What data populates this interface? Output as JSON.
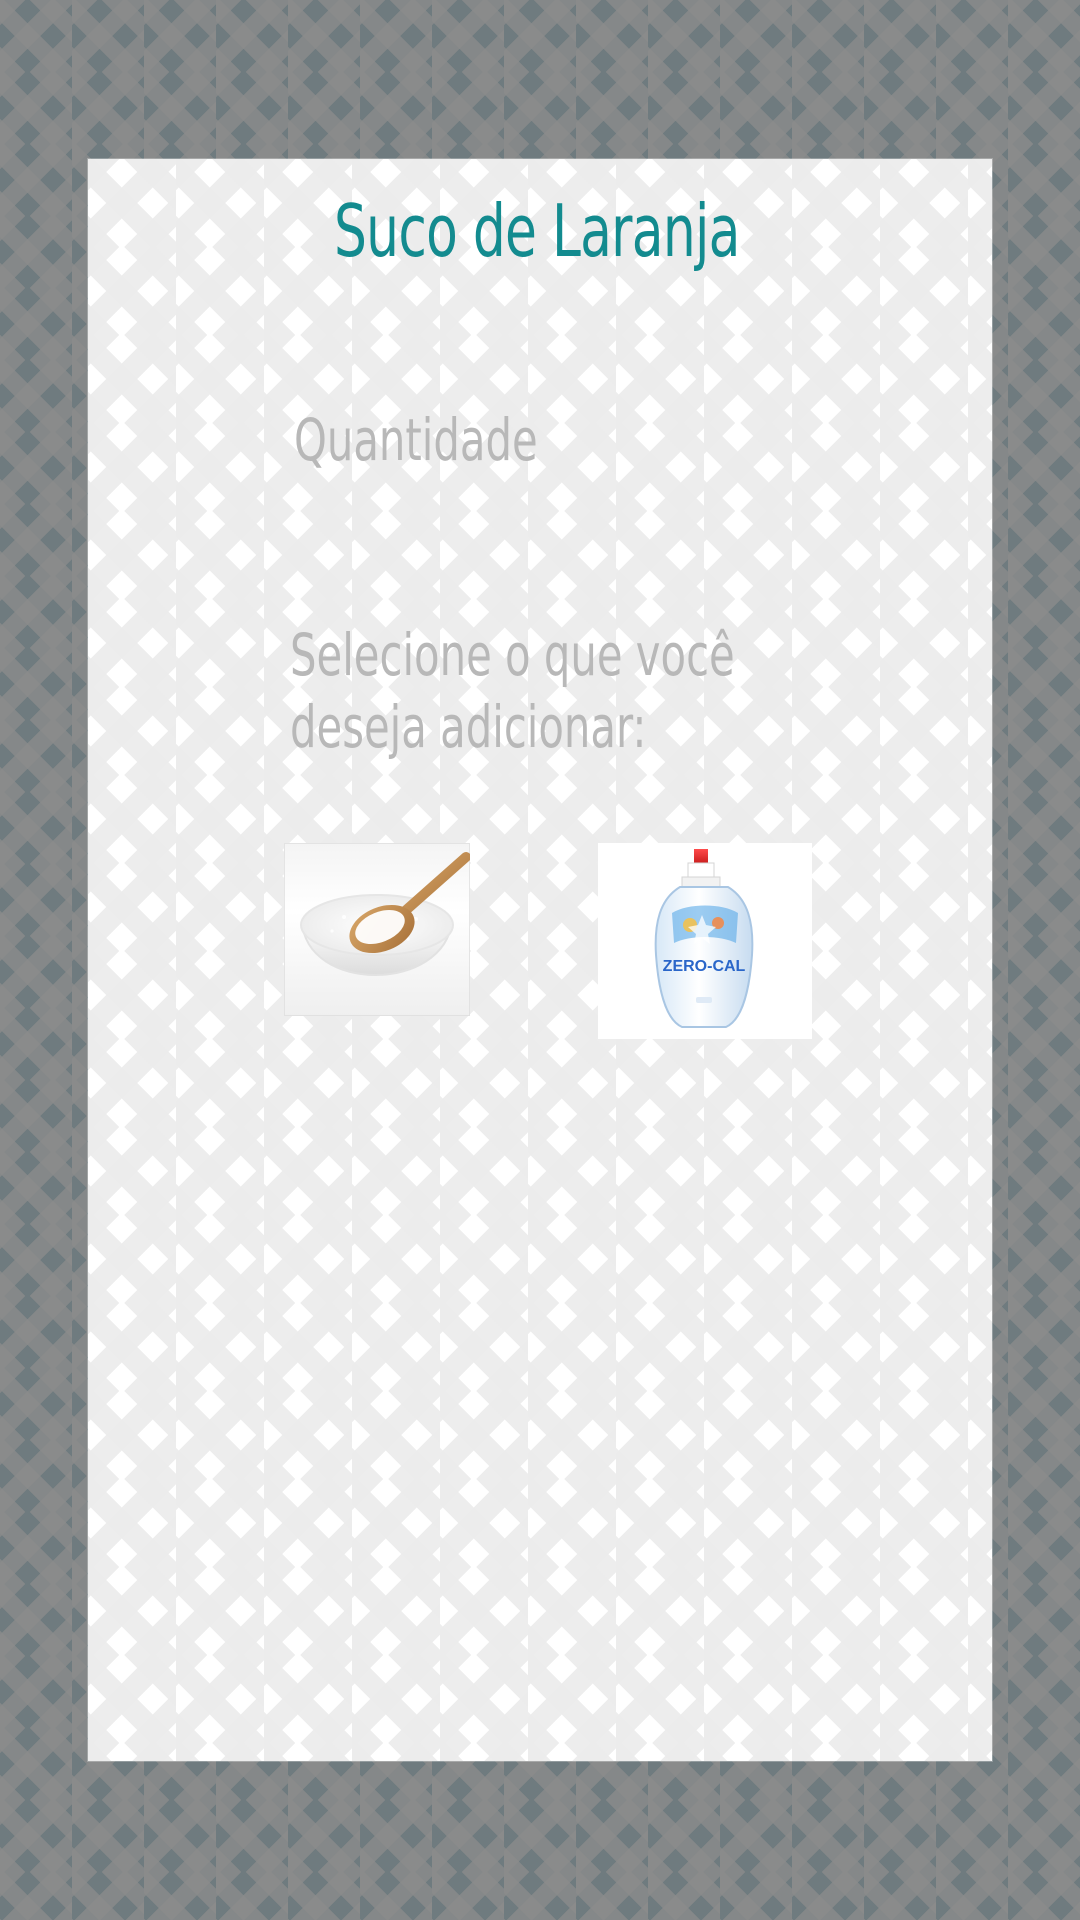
{
  "page": {
    "title": "Suco de Laranja",
    "quantity_label": "Quantidade",
    "prompt": "Selecione o que você deseja adicionar:"
  },
  "options": {
    "sugar": {
      "icon": "sugar-bowl-image"
    },
    "sweetener": {
      "icon": "sweetener-bottle-image",
      "brand_text": "ZERO-CAL"
    }
  },
  "colors": {
    "title": "#138b8f",
    "text_muted": "#b8b8b8",
    "background": "#6f7b7f",
    "card": "#ffffff"
  }
}
